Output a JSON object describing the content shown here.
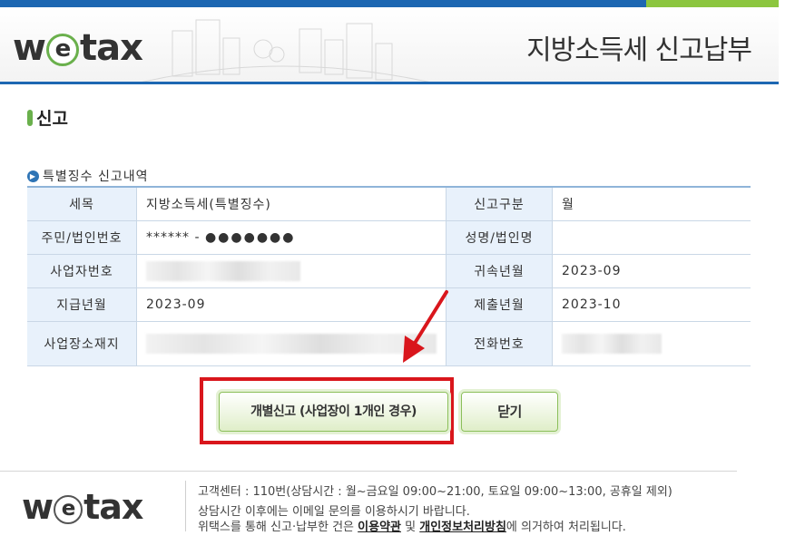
{
  "header": {
    "logo_prefix": "w",
    "logo_e": "e",
    "logo_suffix": "tax",
    "title": "지방소득세 신고납부"
  },
  "section": {
    "title": "신고",
    "subtitle": "특별징수 신고내역"
  },
  "table": {
    "rows": [
      {
        "l1": "세목",
        "v1": "지방소득세(특별징수)",
        "l2": "신고구분",
        "v2": "월"
      },
      {
        "l1": "주민/법인번호",
        "v1_stars": "****** - ",
        "v1_dots": "●●●●●●●",
        "l2": "성명/법인명",
        "v2": ""
      },
      {
        "l1": "사업자번호",
        "v1": "",
        "l2": "귀속년월",
        "v2": "2023-09"
      },
      {
        "l1": "지급년월",
        "v1": "2023-09",
        "l2": "제출년월",
        "v2": "2023-10"
      },
      {
        "l1": "사업장소재지",
        "v1": "",
        "l2": "전화번호",
        "v2": ""
      }
    ]
  },
  "buttons": {
    "individual": "개별신고 (사업장이 1개인 경우)",
    "close": "닫기"
  },
  "footer": {
    "logo_prefix": "w",
    "logo_e": "e",
    "logo_suffix": "tax",
    "line1": "고객센터 : 110번(상담시간 : 월~금요일 09:00~21:00, 토요일 09:00~13:00, 공휴일 제외)",
    "line2": "상담시간 이후에는 이메일 문의를 이용하시기 바랍니다.",
    "line3_pre": "위택스를 통해 신고·납부한 건은 ",
    "terms_link": "이용약관",
    "line3_mid": " 및 ",
    "privacy_link": "개인정보처리방침",
    "line3_post": "에 의거하여 처리됩니다."
  },
  "colors": {
    "brand_blue": "#1d67b2",
    "brand_green": "#8cc63f",
    "highlight_red": "#d9161c"
  }
}
